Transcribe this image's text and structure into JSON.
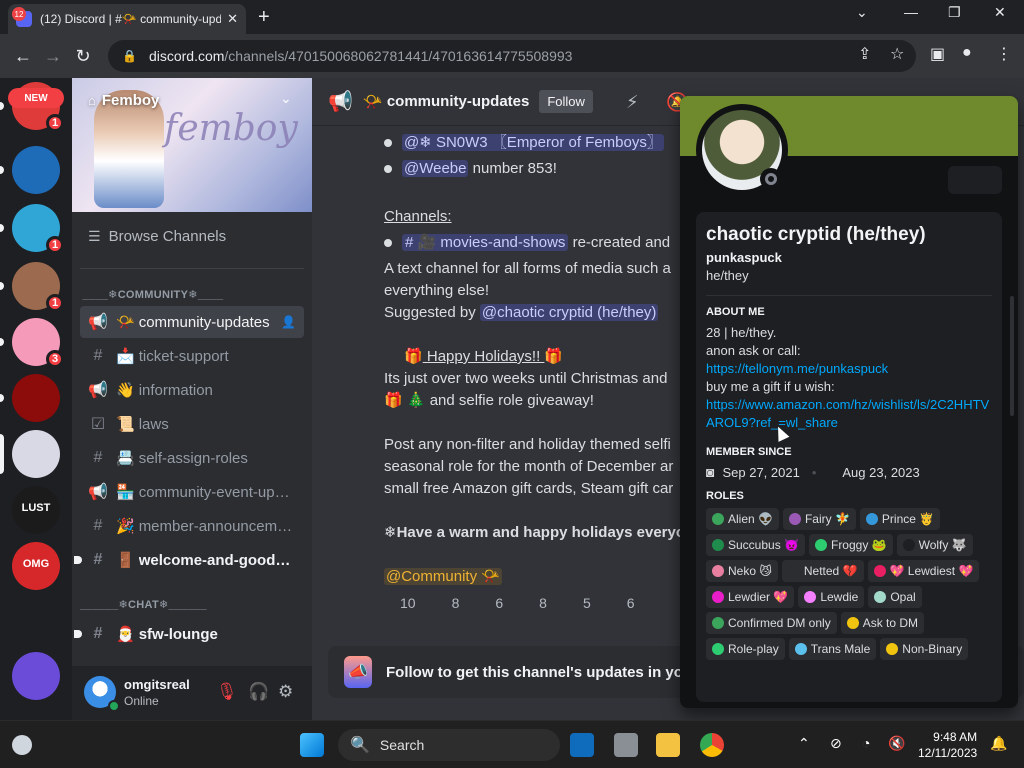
{
  "browser": {
    "tab_title": "(12) Discord | #📯 community-upd…",
    "tab_badge": "12",
    "url_host": "discord.com",
    "url_path": "/channels/470150068062781441/470163614775508993"
  },
  "guilds": {
    "new_tag": "NEW",
    "items": [
      {
        "name": "guild-new",
        "badge": "1",
        "color": "#e03b3b"
      },
      {
        "name": "guild-blue",
        "badge": "",
        "color": "#1e6bb8"
      },
      {
        "name": "guild-anime",
        "badge": "1",
        "color": "#2fa6d6"
      },
      {
        "name": "guild-faces",
        "badge": "1",
        "color": "#9c6b4f"
      },
      {
        "name": "guild-pink",
        "badge": "3",
        "color": "#f59ab8"
      },
      {
        "name": "guild-red",
        "badge": "",
        "color": "#8c0b0b"
      },
      {
        "name": "guild-femboy",
        "badge": "",
        "color": "#d9d9e6"
      },
      {
        "name": "guild-lust",
        "badge": "",
        "color": "#1b1b1b",
        "label": "LUST"
      },
      {
        "name": "guild-omg",
        "badge": "",
        "color": "#d6282a",
        "label": "OMG"
      },
      {
        "name": "guild-santa",
        "badge": "",
        "color": "#1e1f22"
      },
      {
        "name": "guild-purple",
        "badge": "",
        "color": "#6a4cd9"
      }
    ]
  },
  "server": {
    "name": "Femboy",
    "banner_text": "femboy",
    "browse": "Browse Channels",
    "category_community": " ____❄COMMUNITY❄____",
    "category_chat": "______❄CHAT❄______",
    "channels": [
      {
        "icon": "📢",
        "emoji": "📯",
        "label": "community-updates",
        "state": "active"
      },
      {
        "icon": "#",
        "emoji": "📩",
        "label": "ticket-support",
        "state": ""
      },
      {
        "icon": "📢",
        "emoji": "👋",
        "label": "information",
        "state": ""
      },
      {
        "icon": "☑",
        "emoji": "📜",
        "label": "laws",
        "state": ""
      },
      {
        "icon": "#",
        "emoji": "📇",
        "label": "self-assign-roles",
        "state": ""
      },
      {
        "icon": "📢",
        "emoji": "🏪",
        "label": "community-event-up…",
        "state": ""
      },
      {
        "icon": "#",
        "emoji": "🎉",
        "label": "member-announcem…",
        "state": ""
      },
      {
        "icon": "#",
        "emoji": "🚪",
        "label": "welcome-and-goodbye",
        "state": "unread"
      }
    ],
    "chat_channels": [
      {
        "icon": "#",
        "emoji": "🎅",
        "label": "sfw-lounge",
        "state": "unread"
      }
    ]
  },
  "user": {
    "name": "omgitsreal",
    "status": "Online"
  },
  "header": {
    "channel": "community-updates",
    "follow": "Follow",
    "emoji": "📯"
  },
  "messages": {
    "mention1": "@❄ SN0W3 〖Emperor of Femboys〗",
    "mention2": "@Weebe",
    "mention2_tail": " number 853!",
    "channels_label": "Channels:",
    "channel_mention": "#  🎥 movies-and-shows",
    "channel_tail": " re-created and",
    "line_a": "A text channel for all forms of media such a",
    "line_b": "everything else!",
    "suggested": "Suggested by ",
    "suggested_mention": "@chaotic cryptid (he/they)",
    "holiday": " Happy Holidays!! ",
    "line_c": "Its just over two weeks until Christmas and",
    "line_d": " 🎄 and selfie role giveaway!",
    "line_e": "Post any non-filter and holiday themed selfi",
    "line_f": "seasonal role for the month of December ar",
    "line_g": "small free Amazon gift cards, Steam gift car",
    "line_h": "❄Have a warm and happy holidays everyo",
    "role_mention": "@Community 📯",
    "reactions": [
      "10",
      "8",
      "6",
      "8",
      "5",
      "6"
    ],
    "follow_bar": "Follow to get this channel's updates in you"
  },
  "profile": {
    "display_name": "chaotic cryptid (he/they)",
    "username": "punkaspuck",
    "pronouns": "he/they",
    "about_heading": "ABOUT ME",
    "about_1": "28 | he/they.",
    "about_2": "anon ask or call:",
    "link_1": "https://tellonym.me/punkaspuck",
    "about_3": "buy me a gift if u wish:",
    "link_2": "https://www.amazon.com/hz/wishlist/ls/2C2HHTVAROL9?ref_=wl_share",
    "member_heading": "MEMBER SINCE",
    "discord_since": "Sep 27, 2021",
    "server_since": "Aug 23, 2023",
    "roles_heading": "ROLES",
    "roles": [
      {
        "label": "Alien 👽",
        "color": "#3ba55c"
      },
      {
        "label": "Fairy 🧚",
        "color": "#9b59b6"
      },
      {
        "label": "Prince 🤴",
        "color": "#3498db"
      },
      {
        "label": "Succubus 👿",
        "color": "#1f8b4c"
      },
      {
        "label": "Froggy 🐸",
        "color": "#2ecc71"
      },
      {
        "label": "Wolfy 🐺",
        "color": "#1e1f22"
      },
      {
        "label": "Neko 😼",
        "color": "#e87fa0"
      },
      {
        "label": "Netted 💔",
        "color": "#2b2d31"
      },
      {
        "label": "💖 Lewdiest 💖",
        "color": "#e91e63"
      },
      {
        "label": "Lewdier 💖",
        "color": "#e91ec8"
      },
      {
        "label": "Lewdie",
        "color": "#f47fff"
      },
      {
        "label": "Opal",
        "color": "#a3d9c9"
      },
      {
        "label": "Confirmed DM only",
        "color": "#3ba55c"
      },
      {
        "label": "Ask to DM",
        "color": "#f1c40f"
      },
      {
        "label": "Role-play",
        "color": "#2ecc71"
      },
      {
        "label": "Trans Male",
        "color": "#5bc0eb"
      },
      {
        "label": "Non-Binary",
        "color": "#f1c40f"
      }
    ]
  },
  "taskbar": {
    "search": "Search",
    "time": "9:48 AM",
    "date": "12/11/2023"
  }
}
